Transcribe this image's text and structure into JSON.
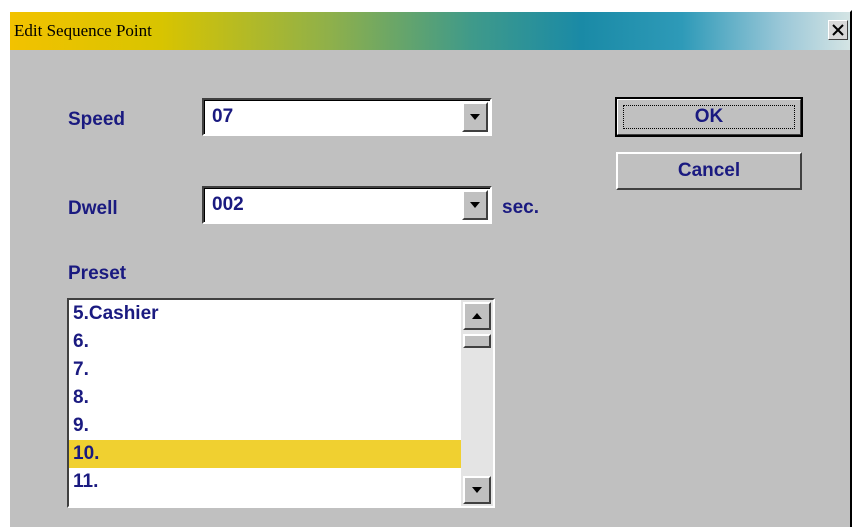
{
  "window": {
    "title": "Edit Sequence Point",
    "close_icon": "close-icon"
  },
  "speed": {
    "label": "Speed",
    "value": "07"
  },
  "dwell": {
    "label": "Dwell",
    "value": "002",
    "unit": "sec."
  },
  "preset": {
    "label": "Preset",
    "items": [
      "5.Cashier",
      "6.",
      "7.",
      "8.",
      "9.",
      "10.",
      "11."
    ],
    "selected_index": 5
  },
  "buttons": {
    "ok": "OK",
    "cancel": "Cancel"
  },
  "colors": {
    "text": "#1a1a80",
    "dialog_bg": "#c0c0c0",
    "selection": "#f0d030"
  }
}
